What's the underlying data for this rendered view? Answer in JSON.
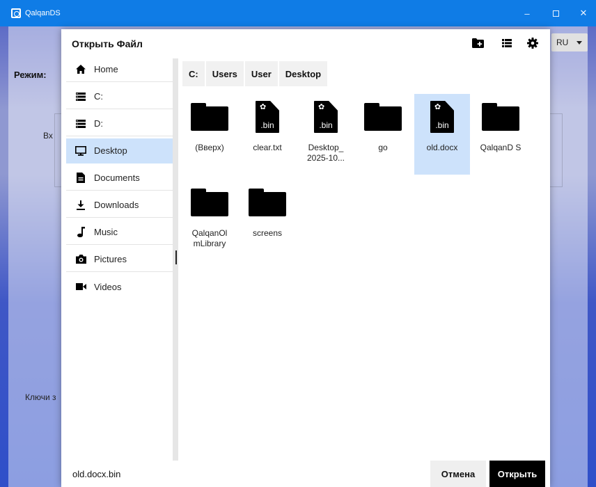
{
  "window": {
    "title": "QalqanDS",
    "minimize": "–",
    "close": "✕"
  },
  "background": {
    "mode_label": "Режим:",
    "input_label": "Вх",
    "keys_label": "Ключи з",
    "language": "RU"
  },
  "dialog": {
    "title": "Открыть Файл"
  },
  "sidebar": {
    "items": [
      {
        "label": "Home",
        "icon": "home-icon"
      },
      {
        "label": "C:",
        "icon": "drive-icon"
      },
      {
        "label": "D:",
        "icon": "drive-icon"
      },
      {
        "label": "Desktop",
        "icon": "monitor-icon",
        "selected": true
      },
      {
        "label": "Documents",
        "icon": "document-icon"
      },
      {
        "label": "Downloads",
        "icon": "download-icon"
      },
      {
        "label": "Music",
        "icon": "music-note-icon"
      },
      {
        "label": "Pictures",
        "icon": "camera-icon"
      },
      {
        "label": "Videos",
        "icon": "video-camera-icon"
      }
    ]
  },
  "breadcrumb": [
    "C:",
    "Users",
    "User",
    "Desktop"
  ],
  "files": [
    {
      "name": "(Вверх)",
      "type": "folder"
    },
    {
      "name": "clear.txt",
      "type": "file",
      "ext": ".bin"
    },
    {
      "name": "Desktop_ 2025-10...",
      "type": "file",
      "ext": ".bin"
    },
    {
      "name": "go",
      "type": "folder"
    },
    {
      "name": "old.docx",
      "type": "file",
      "ext": ".bin",
      "selected": true
    },
    {
      "name": "QalqanD S",
      "type": "folder"
    },
    {
      "name": "QalqanOl mLibrary",
      "type": "folder"
    },
    {
      "name": "screens",
      "type": "folder"
    }
  ],
  "footer": {
    "filename": "old.docx.bin",
    "cancel": "Отмена",
    "open": "Открыть"
  },
  "colors": {
    "titlebar": "#0f7ce6",
    "selection": "#cde2fb",
    "primary_button": "#000000"
  }
}
